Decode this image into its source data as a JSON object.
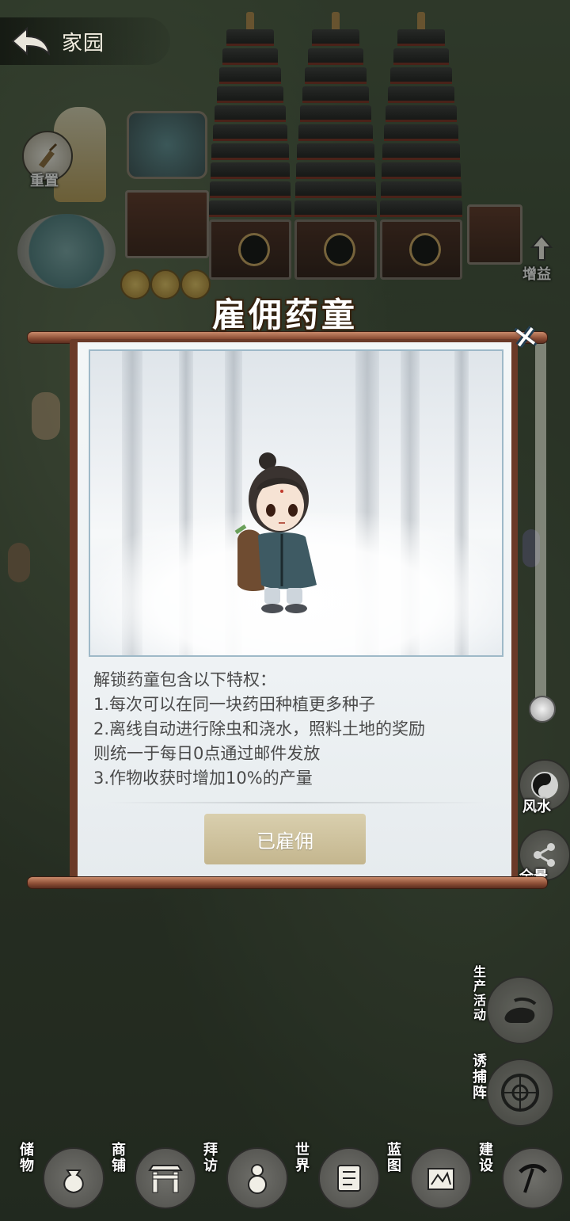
{
  "header": {
    "back_icon": "back-arrow-icon",
    "title": "家园"
  },
  "side_buttons": {
    "reset_label": "重置",
    "boost_label": "增益"
  },
  "modal": {
    "title": "雇佣药童",
    "close_icon": "close-icon",
    "intro": "解锁药童包含以下特权：",
    "perks": [
      "1.每次可以在同一块药田种植更多种子",
      "2.离线自动进行除虫和浇水，照料土地的奖励",
      "则统一于每日0点通过邮件发放",
      "3.作物收获时增加10%的产量"
    ],
    "button_label": "已雇佣"
  },
  "right_buttons": {
    "fengshui_label": "风水",
    "panorama_label": "全景",
    "production_label": "生产活动",
    "trap_label": "诱捕阵"
  },
  "bottom_nav": [
    {
      "label": "储物",
      "icon": "storage-bag-icon"
    },
    {
      "label": "商铺",
      "icon": "shop-gate-icon"
    },
    {
      "label": "拜访",
      "icon": "visit-gourd-icon"
    },
    {
      "label": "世界",
      "icon": "world-scroll-icon"
    },
    {
      "label": "蓝图",
      "icon": "blueprint-icon"
    },
    {
      "label": "建设",
      "icon": "build-pickaxe-icon"
    }
  ]
}
